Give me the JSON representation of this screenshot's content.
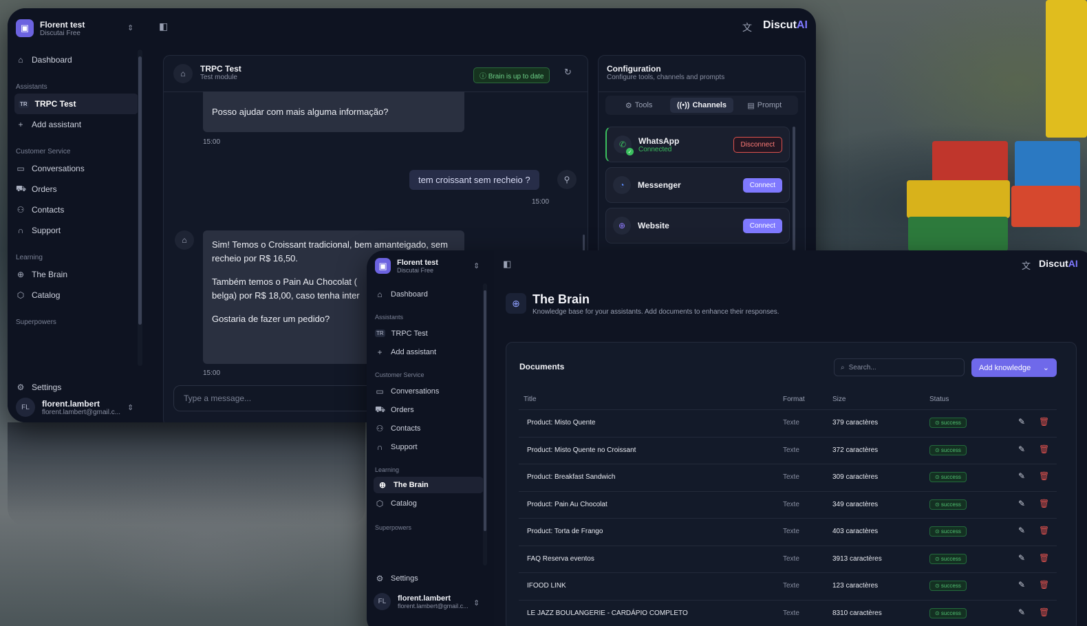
{
  "brand": {
    "name": "Discut",
    "ai": "AI"
  },
  "win1": {
    "org": {
      "name": "Florent test",
      "plan": "Discutai Free"
    },
    "nav": {
      "dashboard": "Dashboard",
      "assistants_section": "Assistants",
      "assistant": "TRPC Test",
      "assistant_badge": "TR",
      "add_assistant": "Add assistant",
      "cs_section": "Customer Service",
      "conversations": "Conversations",
      "orders": "Orders",
      "contacts": "Contacts",
      "support": "Support",
      "learning_section": "Learning",
      "brain": "The Brain",
      "catalog": "Catalog",
      "superpowers_section": "Superpowers",
      "settings": "Settings"
    },
    "user": {
      "initials": "FL",
      "name": "florent.lambert",
      "email": "florent.lambert@gmail.c..."
    },
    "chat": {
      "title": "TRPC Test",
      "subtitle": "Test module",
      "status": "Brain is up to date",
      "msg1": "Posso ajudar com mais alguma informação?",
      "time1": "15:00",
      "user_msg": "tem croissant sem recheio ?",
      "time2": "15:00",
      "msg2_p1": "Sim! Temos o Croissant tradicional, bem amanteigado, sem recheio por R$ 16,50.",
      "msg2_p2": "Também temos o Pain Au Chocolat (",
      "msg2_p2b": "belga) por R$ 18,00, caso tenha inter",
      "msg2_p3": "Gostaria de fazer um pedido?",
      "time3": "15:00",
      "placeholder": "Type a message..."
    },
    "config": {
      "title": "Configuration",
      "subtitle": "Configure tools, channels and prompts",
      "tabs": [
        "Tools",
        "Channels",
        "Prompt"
      ],
      "channels": [
        {
          "name": "WhatsApp",
          "status": "Connected",
          "action": "Disconnect"
        },
        {
          "name": "Messenger",
          "action": "Connect"
        },
        {
          "name": "Website",
          "action": "Connect"
        }
      ]
    }
  },
  "win2": {
    "org": {
      "name": "Florent test",
      "plan": "Discutai Free"
    },
    "nav": {
      "dashboard": "Dashboard",
      "assistants_section": "Assistants",
      "assistant": "TRPC Test",
      "assistant_badge": "TR",
      "add_assistant": "Add assistant",
      "cs_section": "Customer Service",
      "conversations": "Conversations",
      "orders": "Orders",
      "contacts": "Contacts",
      "support": "Support",
      "learning_section": "Learning",
      "brain": "The Brain",
      "catalog": "Catalog",
      "superpowers_section": "Superpowers",
      "settings": "Settings"
    },
    "user": {
      "initials": "FL",
      "name": "florent.lambert",
      "email": "florent.lambert@gmail.c..."
    },
    "page": {
      "title": "The Brain",
      "subtitle": "Knowledge base for your assistants. Add documents to enhance their responses."
    },
    "docs": {
      "title": "Documents",
      "search_placeholder": "Search...",
      "add_button": "Add knowledge",
      "columns": [
        "Title",
        "Format",
        "Size",
        "Status"
      ],
      "rows": [
        {
          "title": "Product: Misto Quente",
          "format": "Texte",
          "size": "379 caractères",
          "status": "success"
        },
        {
          "title": "Product: Misto Quente no Croissant",
          "format": "Texte",
          "size": "372 caractères",
          "status": "success"
        },
        {
          "title": "Product: Breakfast Sandwich",
          "format": "Texte",
          "size": "309 caractères",
          "status": "success"
        },
        {
          "title": "Product: Pain Au Chocolat",
          "format": "Texte",
          "size": "349 caractères",
          "status": "success"
        },
        {
          "title": "Product: Torta de Frango",
          "format": "Texte",
          "size": "403 caractères",
          "status": "success"
        },
        {
          "title": "FAQ Reserva eventos",
          "format": "Texte",
          "size": "3913 caractères",
          "status": "success"
        },
        {
          "title": "IFOOD LINK",
          "format": "Texte",
          "size": "123 caractères",
          "status": "success"
        },
        {
          "title": "LE JAZZ BOULANGERIE - CARDÁPIO COMPLETO",
          "format": "Texte",
          "size": "8310 caractères",
          "status": "success"
        }
      ]
    }
  },
  "colors": {
    "accent": "#7f79ff",
    "success": "#3bbf5e",
    "danger": "#e0524e",
    "bg": "#0e1321"
  }
}
